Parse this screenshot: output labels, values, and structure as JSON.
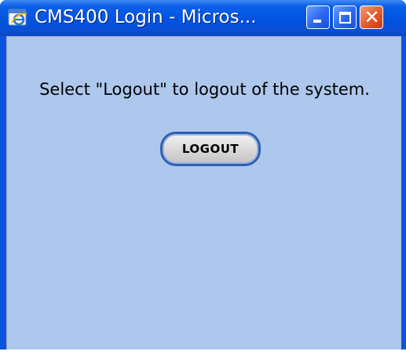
{
  "window": {
    "title": "CMS400 Login - Micros...",
    "icon": "internet-explorer-icon",
    "controls": {
      "minimize_icon": "minimize-icon",
      "maximize_icon": "maximize-icon",
      "close_icon": "close-icon",
      "close_glyph": "✕"
    }
  },
  "content": {
    "message": "Select \"Logout\" to logout of the system.",
    "logout_label": "LOGOUT"
  },
  "colors": {
    "titlebar": "#0053e0",
    "client_background": "#aec7ec",
    "close_button": "#e35a2c",
    "button_border": "#2f5fb0"
  }
}
